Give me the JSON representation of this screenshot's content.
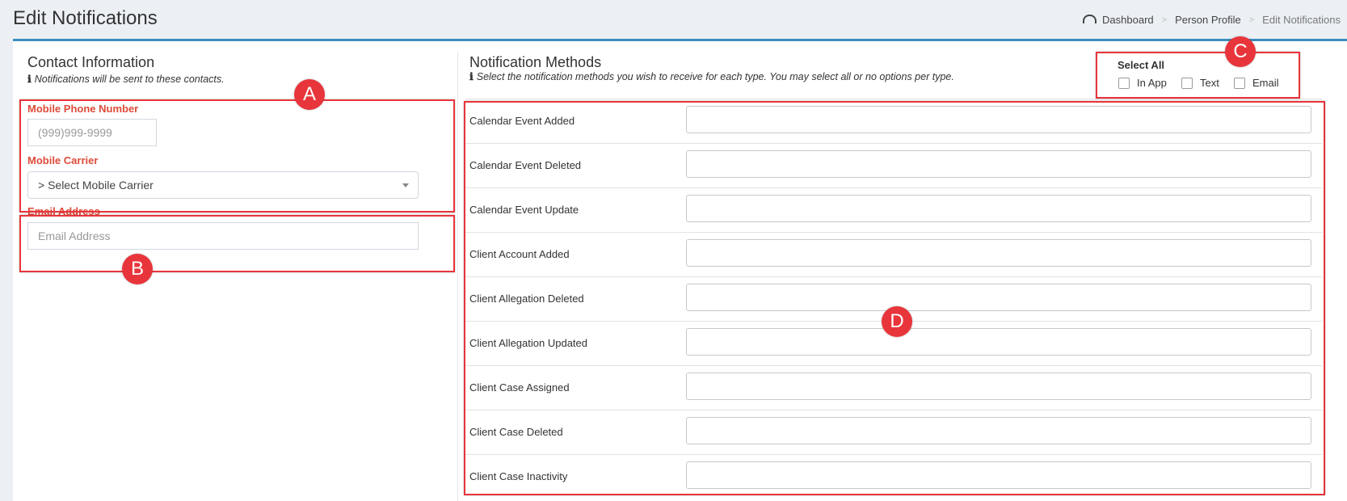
{
  "page": {
    "title": "Edit Notifications"
  },
  "breadcrumb": {
    "items": [
      "Dashboard",
      "Person Profile"
    ],
    "current": "Edit Notifications"
  },
  "contact": {
    "title": "Contact Information",
    "hint": "Notifications will be sent to these contacts.",
    "mobile_label": "Mobile Phone Number",
    "mobile_placeholder": "(999)999-9999",
    "carrier_label": "Mobile Carrier",
    "carrier_selected": "> Select Mobile Carrier",
    "email_label": "Email Address",
    "email_placeholder": "Email Address"
  },
  "methods": {
    "title": "Notification Methods",
    "hint": "Select the notification methods you wish to receive for each type. You may select all or no options per type.",
    "select_all_label": "Select All",
    "options": [
      "In App",
      "Text",
      "Email"
    ],
    "rows": [
      "Calendar Event Added",
      "Calendar Event Deleted",
      "Calendar Event Update",
      "Client Account Added",
      "Client Allegation Deleted",
      "Client Allegation Updated",
      "Client Case Assigned",
      "Client Case Deleted",
      "Client Case Inactivity"
    ]
  },
  "annotations": [
    "A",
    "B",
    "C",
    "D"
  ],
  "colors": {
    "accent": "#3c8dbc",
    "required_label": "#dd4b39",
    "annotation": "#e8353b"
  }
}
